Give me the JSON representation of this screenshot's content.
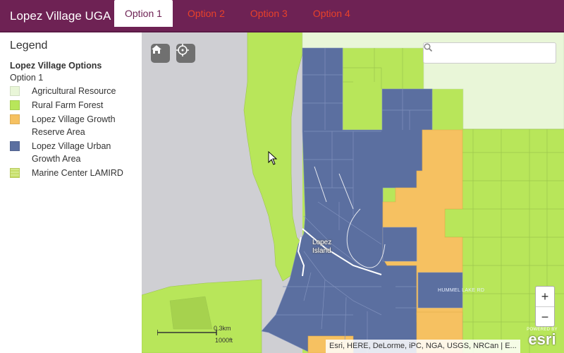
{
  "header": {
    "title": "Lopez Village UGA",
    "tabs": [
      {
        "label": "Option 1",
        "active": true
      },
      {
        "label": "Option 2",
        "active": false
      },
      {
        "label": "Option 3",
        "active": false
      },
      {
        "label": "Option 4",
        "active": false
      }
    ]
  },
  "legend": {
    "title": "Legend",
    "layer_name": "Lopez Village Options",
    "sublayer": "Option 1",
    "items": [
      {
        "label": "Agricultural Resource",
        "color": "#e9f6d8"
      },
      {
        "label": "Rural Farm Forest",
        "color": "#b8e65a"
      },
      {
        "label": "Lopez Village Growth Reserve Area",
        "color": "#f6c161"
      },
      {
        "label": "Lopez Village Urban Growth Area",
        "color": "#5b6fa0"
      },
      {
        "label": "Marine Center LAMIRD",
        "color": "#d4e98a"
      }
    ]
  },
  "map": {
    "search": {
      "placeholder": ""
    },
    "zoom_in": "+",
    "zoom_out": "−",
    "place_label": "Lopez Island",
    "road_label": "HUMMEL LAKE RD",
    "scale": {
      "km": "0.3km",
      "ft": "1000ft"
    },
    "attribution": "Esri, HERE, DeLorme, iPC, NGA, USGS, NRCan | E...",
    "esri": {
      "powered_by": "POWERED BY",
      "logo": "esri"
    }
  },
  "colors": {
    "header_bg": "#6e2254",
    "tab_inactive": "#e8412a",
    "water": "#cfcfd3",
    "agricultural": "#e9f6d8",
    "rural_farm": "#b8e65a",
    "growth_reserve": "#f6c161",
    "urban_growth": "#5b6fa0"
  }
}
